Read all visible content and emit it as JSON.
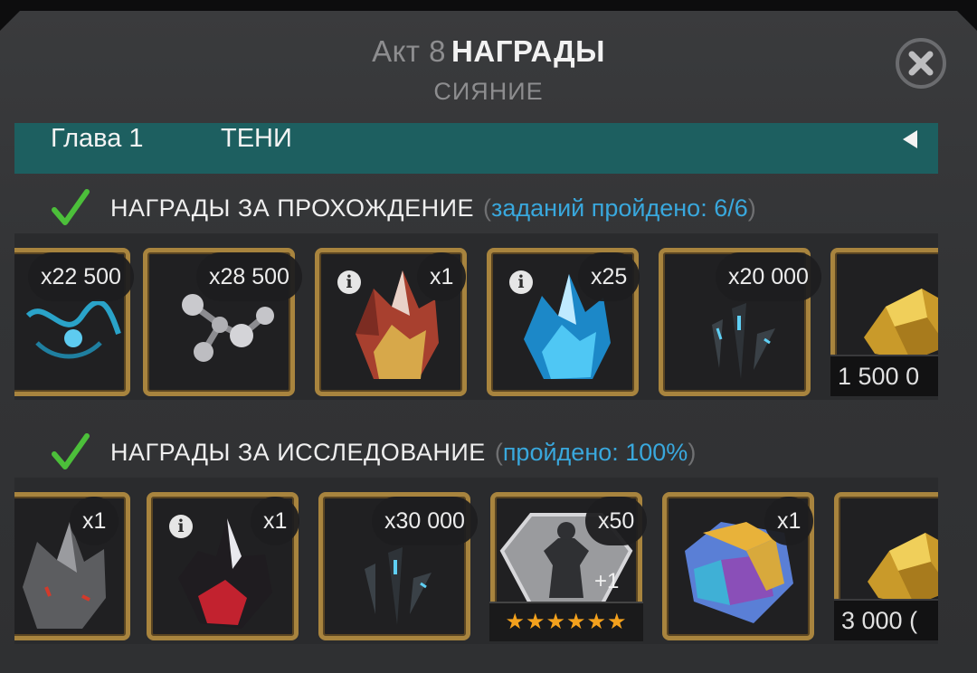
{
  "header": {
    "act_prefix": "Акт 8",
    "title": "НАГРАДЫ",
    "subtitle": "СИЯНИЕ"
  },
  "chapter": {
    "number_label": "Глава 1",
    "name": "ТЕНИ"
  },
  "sections": [
    {
      "label": "НАГРАДЫ ЗА ПРОХОЖДЕНИЕ",
      "bracket_open": "(",
      "progress": "заданий пройдено: 6/6",
      "bracket_close": ")",
      "items": [
        {
          "quantity": "x22 500",
          "icon": "blue-rune-icon"
        },
        {
          "quantity": "x28 500",
          "icon": "silver-molecule-icon"
        },
        {
          "quantity": "x1",
          "icon": "red-gold-crystal-icon",
          "info": "i"
        },
        {
          "quantity": "x25",
          "icon": "blue-crystal-icon",
          "info": "i"
        },
        {
          "quantity": "x20 000",
          "icon": "dark-shard-icon"
        },
        {
          "amount": "1 500 0",
          "icon": "gold-nugget-icon"
        }
      ]
    },
    {
      "label": "НАГРАДЫ ЗА ИССЛЕДОВАНИЕ",
      "bracket_open": "(",
      "progress": "пройдено: 100%",
      "bracket_close": ")",
      "items": [
        {
          "quantity": "x1",
          "icon": "grey-crystal-icon"
        },
        {
          "quantity": "x1",
          "icon": "red-black-crystal-icon",
          "info": "i"
        },
        {
          "quantity": "x30 000",
          "icon": "dark-shard-icon"
        },
        {
          "quantity": "x50",
          "icon": "signature-stone-icon",
          "overlay": "+1",
          "stars": "★★★★★★"
        },
        {
          "quantity": "x1",
          "icon": "rainbow-cube-icon"
        },
        {
          "amount": "3 000 (",
          "icon": "gold-nugget-icon"
        }
      ]
    }
  ],
  "colors": {
    "panel": "#333436",
    "chapter_bar": "#1d5f60",
    "card_border": "#a8843e",
    "progress_text": "#39a8dd",
    "check": "#4cbf3a",
    "stars": "#f3a11d"
  }
}
